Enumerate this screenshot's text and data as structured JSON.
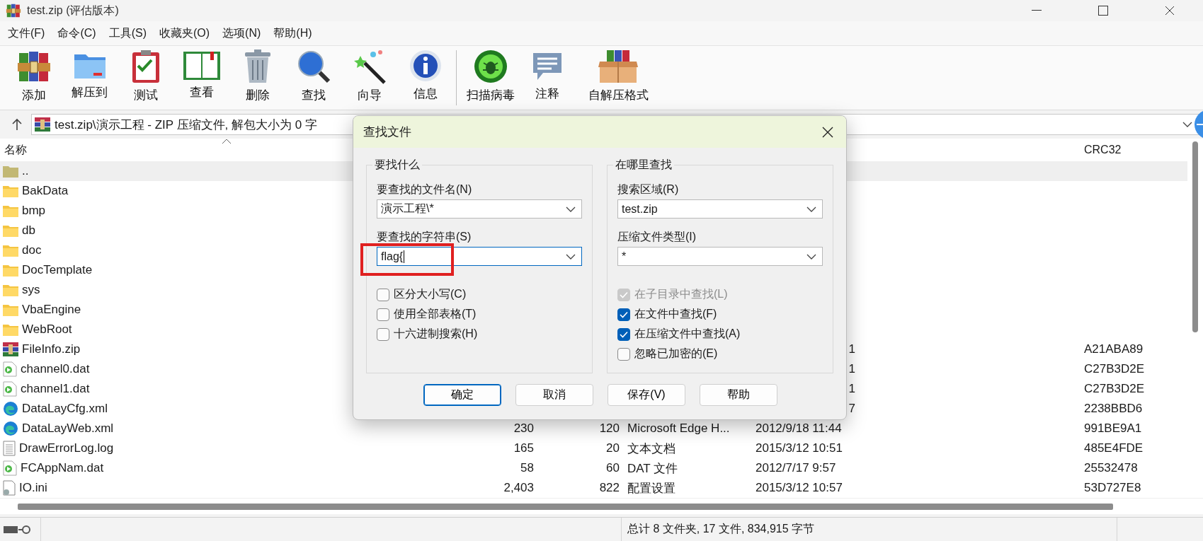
{
  "window": {
    "title": "test.zip (评估版本)"
  },
  "menu": [
    "文件(F)",
    "命令(C)",
    "工具(S)",
    "收藏夹(O)",
    "选项(N)",
    "帮助(H)"
  ],
  "toolbar": {
    "main": [
      "添加",
      "解压到",
      "测试",
      "查看",
      "删除",
      "查找",
      "向导",
      "信息"
    ],
    "extra": [
      "扫描病毒",
      "注释",
      "自解压格式"
    ]
  },
  "address": {
    "path": "test.zip\\演示工程 - ZIP 压缩文件, 解包大小为 0 字"
  },
  "file_list": {
    "columns": [
      {
        "label": "名称",
        "sorted": true
      },
      {
        "label": "CRC32",
        "sorted": false
      }
    ],
    "rows": [
      {
        "kind": "parent",
        "name": "..",
        "selected": true
      },
      {
        "kind": "folder",
        "name": "BakData",
        "selected": false
      },
      {
        "kind": "folder",
        "name": "bmp",
        "selected": false
      },
      {
        "kind": "folder",
        "name": "db",
        "selected": false
      },
      {
        "kind": "folder",
        "name": "doc",
        "selected": false
      },
      {
        "kind": "folder",
        "name": "DocTemplate",
        "selected": false
      },
      {
        "kind": "folder",
        "name": "sys",
        "selected": false
      },
      {
        "kind": "folder",
        "name": "VbaEngine",
        "selected": false
      },
      {
        "kind": "folder",
        "name": "WebRoot",
        "selected": false
      },
      {
        "kind": "zip",
        "name": "FileInfo.zip",
        "modified": "1",
        "crc": "A21ABA89",
        "selected": false
      },
      {
        "kind": "video",
        "name": "channel0.dat",
        "modified": "1",
        "crc": "C27B3D2E",
        "selected": false
      },
      {
        "kind": "video",
        "name": "channel1.dat",
        "modified": "1",
        "crc": "C27B3D2E",
        "selected": false
      },
      {
        "kind": "edge",
        "name": "DataLayCfg.xml",
        "modified": "7",
        "crc": "2238BBD6",
        "selected": false
      },
      {
        "kind": "edge",
        "name": "DataLayWeb.xml",
        "size": "230",
        "packed": "120",
        "type": "Microsoft Edge H...",
        "modified": "2012/9/18 11:44",
        "crc": "991BE9A1",
        "selected": false
      },
      {
        "kind": "text",
        "name": "DrawErrorLog.log",
        "size": "165",
        "packed": "20",
        "type": "文本文档",
        "modified": "2015/3/12 10:51",
        "crc": "485E4FDE",
        "selected": false
      },
      {
        "kind": "video",
        "name": "FCAppNam.dat",
        "size": "58",
        "packed": "60",
        "type": "DAT 文件",
        "modified": "2012/7/17 9:57",
        "crc": "25532478",
        "selected": false
      },
      {
        "kind": "config",
        "name": "IO.ini",
        "size": "2,403",
        "packed": "822",
        "type": "配置设置",
        "modified": "2015/3/12 10:57",
        "crc": "53D727E8",
        "selected": false
      }
    ]
  },
  "dialog": {
    "title": "查找文件",
    "groups": [
      {
        "title": "要找什么",
        "fields": [
          {
            "label": "要查找的文件名(N)",
            "value": "演示工程\\*",
            "focused": false
          },
          {
            "label": "要查找的字符串(S)",
            "value": "flag{",
            "focused": true
          }
        ],
        "options": [
          {
            "label": "区分大小写(C)",
            "checked": false,
            "disabled": false
          },
          {
            "label": "使用全部表格(T)",
            "checked": false,
            "disabled": false
          },
          {
            "label": "十六进制搜索(H)",
            "checked": false,
            "disabled": false
          }
        ]
      },
      {
        "title": "在哪里查找",
        "fields": [
          {
            "label": "搜索区域(R)",
            "value": "test.zip",
            "focused": false
          },
          {
            "label": "压缩文件类型(I)",
            "value": "*",
            "focused": false
          }
        ],
        "options": [
          {
            "label": "在子目录中查找(L)",
            "checked": true,
            "disabled": true
          },
          {
            "label": "在文件中查找(F)",
            "checked": true,
            "disabled": false
          },
          {
            "label": "在压缩文件中查找(A)",
            "checked": true,
            "disabled": false
          },
          {
            "label": "忽略已加密的(E)",
            "checked": false,
            "disabled": false
          }
        ]
      }
    ],
    "buttons": [
      {
        "label": "确定",
        "default": true
      },
      {
        "label": "取消",
        "default": false
      },
      {
        "label": "保存(V)",
        "default": false
      },
      {
        "label": "帮助",
        "default": false
      }
    ]
  },
  "annotation": {
    "kind": "box"
  },
  "status_bar": {
    "text": "总计 8 文件夹, 17 文件, 834,915 字节"
  }
}
